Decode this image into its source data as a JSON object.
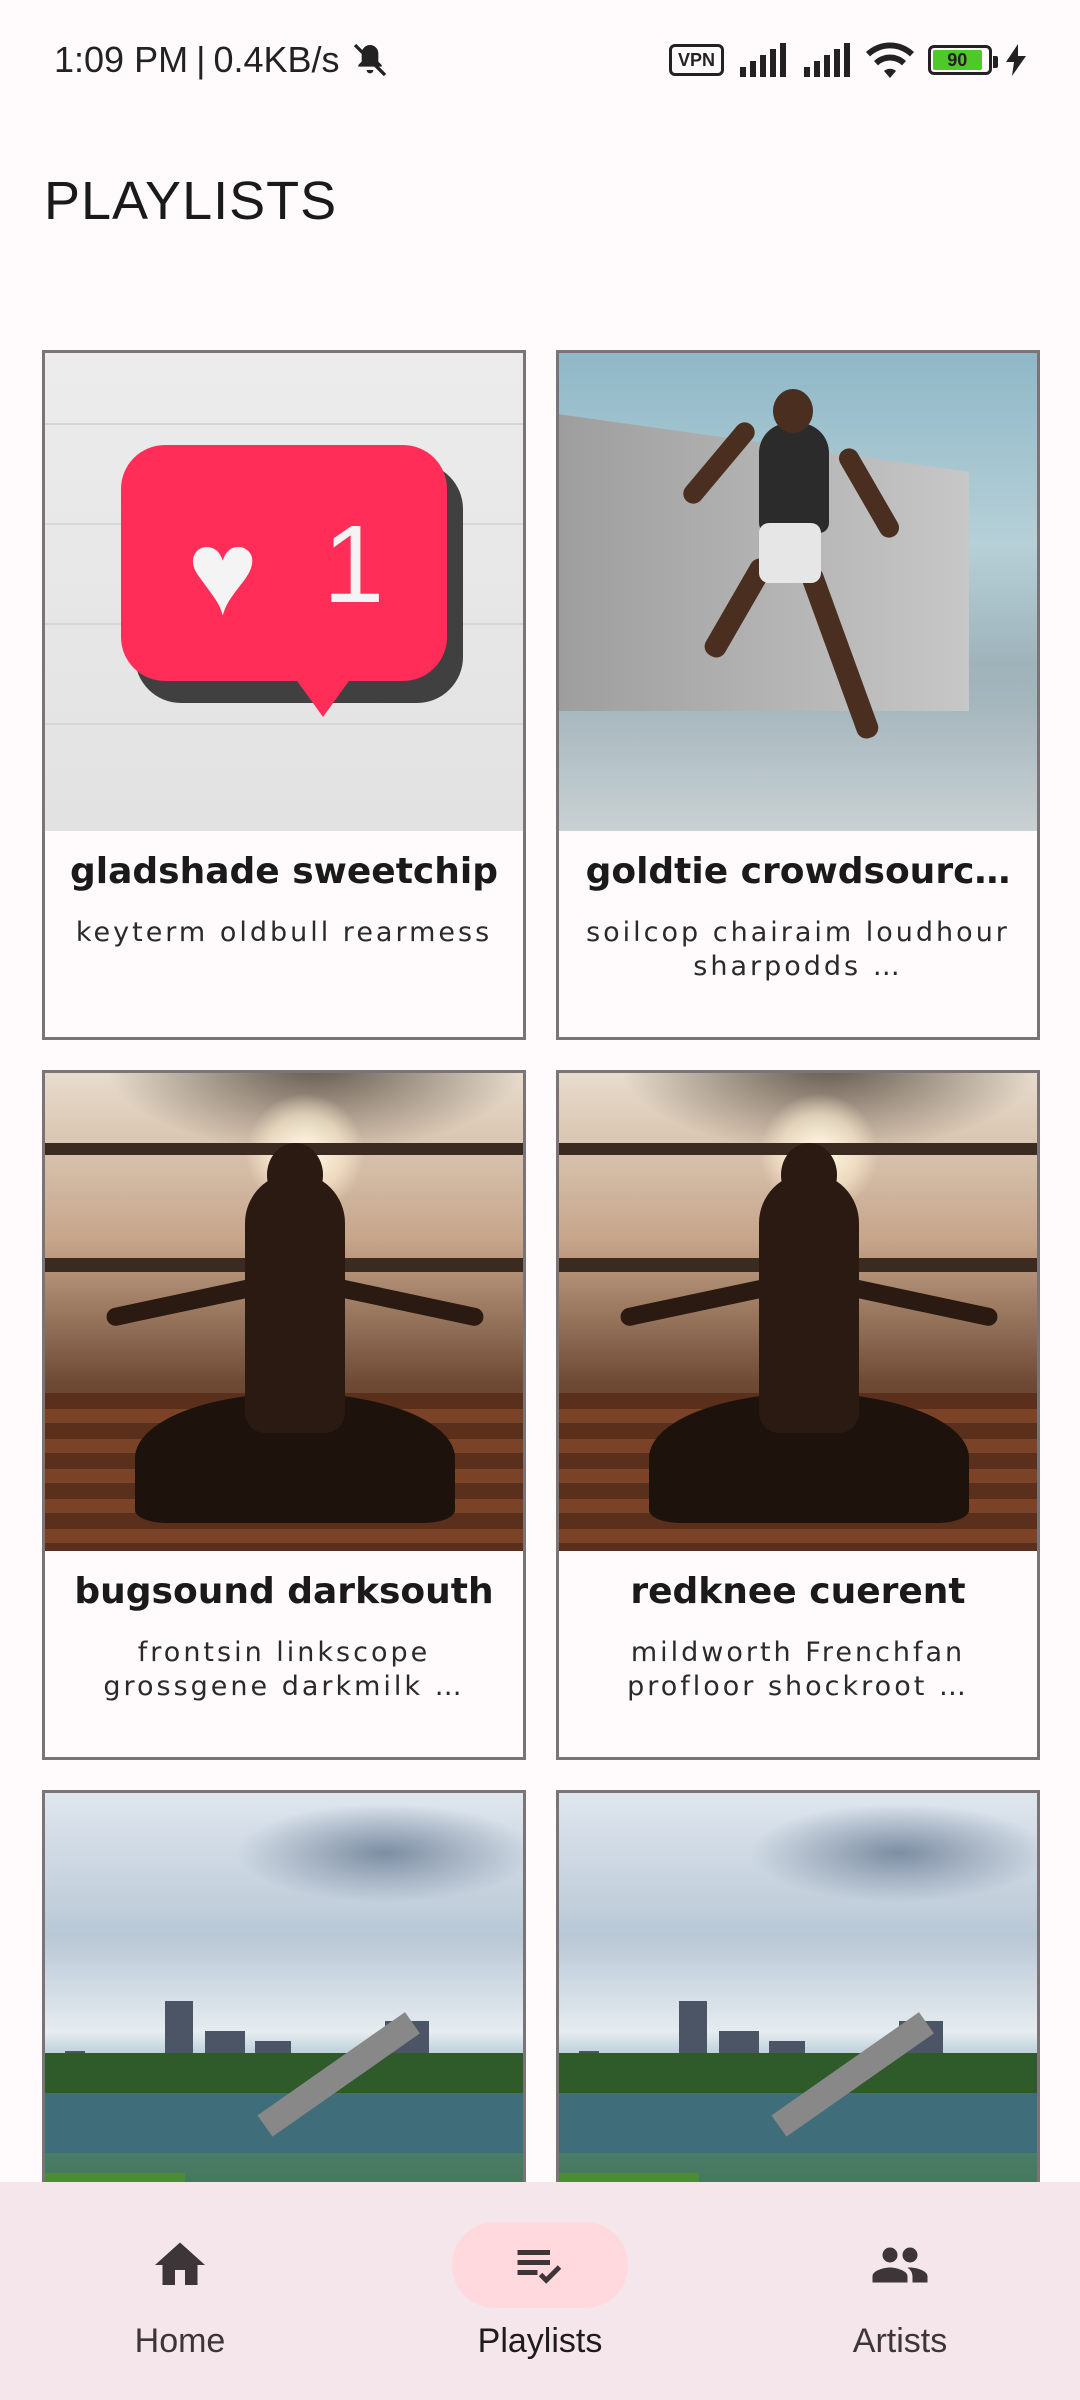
{
  "status_bar": {
    "time": "1:09 PM",
    "separator": "|",
    "speed": "0.4KB/s",
    "vpn": "VPN",
    "battery": "90"
  },
  "page": {
    "title": "PLAYLISTS"
  },
  "playlists": [
    {
      "title": "gladshade sweetchip",
      "subtitle": "keyterm oldbull rearmess",
      "image": "like-bubble-wall"
    },
    {
      "title": "goldtie crowdsourc…",
      "subtitle": "soilcop chairaim loudhour sharpodds …",
      "image": "athlete-jump"
    },
    {
      "title": "bugsound darksouth",
      "subtitle": "frontsin linkscope grossgene darkmilk …",
      "image": "yoga-sunset"
    },
    {
      "title": "redknee cuerent",
      "subtitle": "mildworth Frenchfan profloor shockroot …",
      "image": "yoga-sunset"
    },
    {
      "title": "",
      "subtitle": "",
      "image": "city-skyline"
    },
    {
      "title": "",
      "subtitle": "",
      "image": "city-skyline"
    }
  ],
  "bottom_nav": {
    "items": [
      {
        "label": "Home",
        "icon": "home-icon",
        "active": false
      },
      {
        "label": "Playlists",
        "icon": "playlist-check-icon",
        "active": true
      },
      {
        "label": "Artists",
        "icon": "people-icon",
        "active": false
      }
    ]
  },
  "colors": {
    "background": "#fffbfc",
    "nav_background": "#f4e6ea",
    "nav_active_pill": "#ffd9de",
    "card_border": "#7a7476"
  }
}
